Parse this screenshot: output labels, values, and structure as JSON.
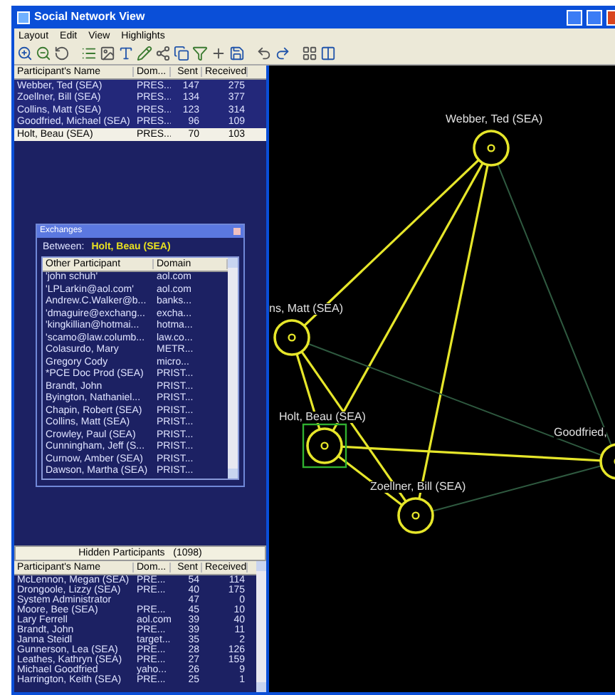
{
  "window": {
    "title": "Social Network View"
  },
  "menu": [
    "Layout",
    "Edit",
    "View",
    "Highlights"
  ],
  "participants": {
    "columns": [
      "Participant's Name",
      "Dom...",
      "Sent",
      "Received"
    ],
    "rows": [
      {
        "cells": [
          "Webber, Ted (SEA)",
          "PRES...",
          "147",
          "275"
        ],
        "selected": false
      },
      {
        "cells": [
          "Zoellner, Bill (SEA)",
          "PRES...",
          "134",
          "377"
        ],
        "selected": false
      },
      {
        "cells": [
          "Collins, Matt (SEA)",
          "PRES...",
          "123",
          "314"
        ],
        "selected": false
      },
      {
        "cells": [
          "Goodfried, Michael (SEA)",
          "PRES...",
          "96",
          "109"
        ],
        "selected": false
      },
      {
        "cells": [
          "Holt, Beau (SEA)",
          "PRES...",
          "70",
          "103"
        ],
        "selected": true
      }
    ]
  },
  "exchanges": {
    "title": "Exchanges",
    "between_label": "Between:",
    "between_value": "Holt, Beau (SEA)",
    "columns": [
      "Other Participant",
      "Domain"
    ],
    "rows": [
      [
        "'john schuh'",
        "aol.com"
      ],
      [
        "'LPLarkin@aol.com'",
        "aol.com"
      ],
      [
        "Andrew.C.Walker@b...",
        "banks..."
      ],
      [
        "'dmaguire@exchang...",
        "excha..."
      ],
      [
        "'kingkillian@hotmai...",
        "hotma..."
      ],
      [
        "'scamo@law.columb...",
        "law.co..."
      ],
      [
        "Colasurdo, Mary",
        "METR..."
      ],
      [
        "Gregory Cody",
        "micro..."
      ],
      [
        "*PCE Doc Prod (SEA)",
        "PRIST..."
      ],
      [
        "Brandt, John",
        "PRIST..."
      ],
      [
        "Byington, Nathaniel...",
        "PRIST..."
      ],
      [
        "Chapin, Robert (SEA)",
        "PRIST..."
      ],
      [
        "Collins, Matt (SEA)",
        "PRIST..."
      ],
      [
        "Crowley, Paul (SEA)",
        "PRIST..."
      ],
      [
        "Cunningham, Jeff (S...",
        "PRIST..."
      ],
      [
        "Curnow, Amber (SEA)",
        "PRIST..."
      ],
      [
        "Dawson, Martha (SEA)",
        "PRIST..."
      ]
    ]
  },
  "hidden": {
    "title": "Hidden Participants   (1098)",
    "columns": [
      "Participant's Name",
      "Dom...",
      "Sent",
      "Received"
    ],
    "rows": [
      [
        "McLennon, Megan (SEA)",
        "PRE...",
        "54",
        "114"
      ],
      [
        "Drongoole, Lizzy (SEA)",
        "PRE...",
        "40",
        "175"
      ],
      [
        "System Administrator",
        "",
        "47",
        "0"
      ],
      [
        "Moore, Bee (SEA)",
        "PRE...",
        "45",
        "10"
      ],
      [
        "Lary Ferrell",
        "aol.com",
        "39",
        "40"
      ],
      [
        "Brandt, John",
        "PRE...",
        "39",
        "11"
      ],
      [
        "Janna Steidl",
        "target...",
        "35",
        "2"
      ],
      [
        "Gunnerson, Lea (SEA)",
        "PRE...",
        "28",
        "126"
      ],
      [
        "Leathes, Kathryn (SEA)",
        "PRE...",
        "27",
        "159"
      ],
      [
        "Michael Goodfried",
        "yaho...",
        "26",
        "9"
      ],
      [
        "Harrington, Keith (SEA)",
        "PRE...",
        "25",
        "1"
      ]
    ]
  },
  "graph": {
    "nodes": [
      {
        "label": "Webber, Ted (SEA)",
        "selected": false
      },
      {
        "label": "ns, Matt (SEA)",
        "selected": false
      },
      {
        "label": "Holt, Beau (SEA)",
        "selected": true
      },
      {
        "label": "Zoellner, Bill (SEA)",
        "selected": false
      },
      {
        "label": "Goodfried, ",
        "selected": false
      }
    ]
  }
}
